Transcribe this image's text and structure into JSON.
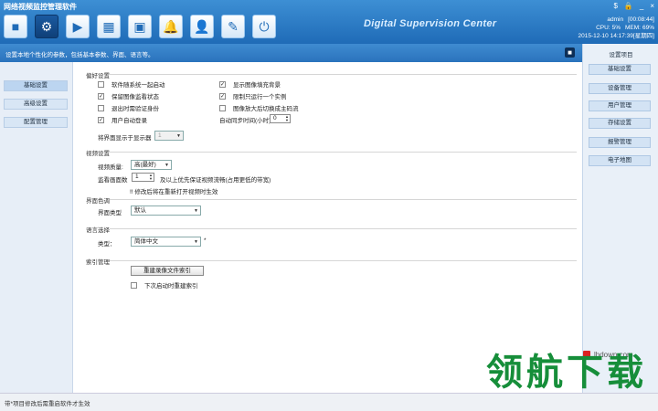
{
  "app": {
    "title": "网络视频监控管理软件",
    "brand": "Digital Supervision Center",
    "window_controls": [
      "$",
      "🔒",
      "_",
      "×"
    ]
  },
  "toolbar": [
    {
      "name": "camera-icon",
      "glyph": "■"
    },
    {
      "name": "gear-icon",
      "glyph": "⚙"
    },
    {
      "name": "play-icon",
      "glyph": "▶"
    },
    {
      "name": "grid-icon",
      "glyph": "▦"
    },
    {
      "name": "map-icon",
      "glyph": "▣"
    },
    {
      "name": "bell-icon",
      "glyph": "🔔"
    },
    {
      "name": "user-icon",
      "glyph": "👤"
    },
    {
      "name": "notepad-icon",
      "glyph": "✎"
    },
    {
      "name": "power-icon",
      "glyph": "⏻"
    }
  ],
  "status": {
    "user": "admin",
    "time_elapsed": "[00:08:44]",
    "cpu_label": "CPU:",
    "cpu": "5%",
    "mem_label": "MEM:",
    "mem": "69%",
    "datetime": "2015-12-10 14:17:39[星期四]"
  },
  "subbar": {
    "text": "设置本地个性化的参数，包括基本参数、界面、语言等。"
  },
  "left_nav": [
    "基础设置",
    "高级设置",
    "配置管理"
  ],
  "right_panel": {
    "title": "设置项目",
    "items": [
      "基础设置",
      "设备管理",
      "用户管理",
      "存储设置",
      "报警管理",
      "电子地图"
    ]
  },
  "sections": {
    "pref": "偏好设置",
    "video": "视频设置",
    "ui": "界面色调",
    "lang": "语言选择",
    "index": "索引管理"
  },
  "pref": {
    "cb_autostart": "软件随系统一起启动",
    "cb_save_state": "保留图像监看状态",
    "cb_exit_verify": "退出时需验证身份",
    "cb_autologin": "用户自动登录",
    "cb_fill_bg": "显示图像填充背景",
    "cb_single_instance": "限制只运行一个实例",
    "cb_zoom_stream": "图像放大后切换成主码流",
    "autologout_label": "自动同步时间(小时)",
    "autologout_value": "0",
    "monitor_label": "将界面显示于显示器",
    "monitor_value": "1"
  },
  "video": {
    "quality_label": "视频质量:",
    "quality_value": "高(最好)",
    "count_label": "监看画面数",
    "count_value": "1",
    "count_hint": "及以上优先保证视频流畅(占用更低的带宽)",
    "note": "!! 修改后将在重新打开视频时生效"
  },
  "ui": {
    "type_label": "界面类型",
    "type_value": "默认"
  },
  "lang": {
    "type_label": "类型：",
    "type_value": "简体中文",
    "star": "*"
  },
  "index": {
    "rebuild_button": "重建录像文件索引",
    "cb_rebuild_next": "下次启动时重建索引"
  },
  "footer": {
    "note": "带*项目修改后需重启软件才生效"
  },
  "watermark": {
    "text": "领航下载",
    "url": "lhdown.com"
  }
}
